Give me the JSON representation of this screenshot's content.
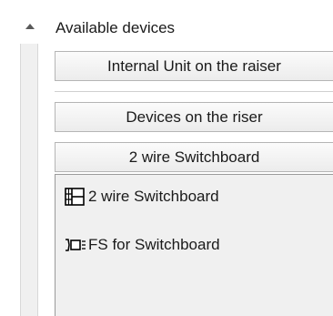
{
  "header": {
    "title": "Available devices"
  },
  "categories": [
    {
      "label": "Internal Unit on the raiser"
    },
    {
      "label": "Devices on the riser"
    },
    {
      "label": "2 wire Switchboard"
    }
  ],
  "devices": [
    {
      "label": "2 wire Switchboard",
      "icon": "switchboard-icon"
    },
    {
      "label": "FS for Switchboard",
      "icon": "power-supply-icon"
    }
  ]
}
